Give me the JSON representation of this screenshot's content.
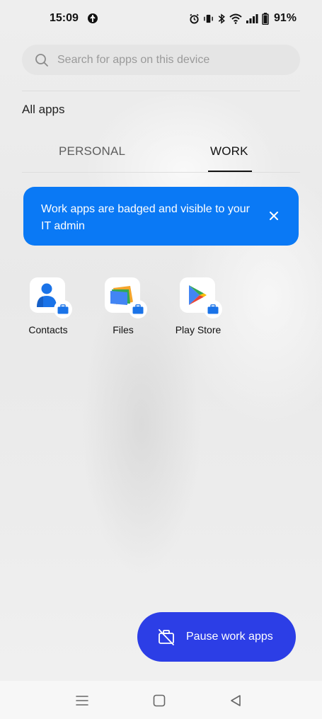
{
  "status_bar": {
    "time": "15:09",
    "battery": "91%",
    "icons": [
      "alarm-icon",
      "vibrate-icon",
      "bluetooth-icon",
      "wifi-icon",
      "signal-icon",
      "battery-icon"
    ]
  },
  "search": {
    "placeholder": "Search for apps on this device"
  },
  "all_apps_label": "All apps",
  "tabs": [
    {
      "label": "PERSONAL",
      "selected": false
    },
    {
      "label": "WORK",
      "selected": true
    }
  ],
  "banner": {
    "text": "Work apps are badged and visible to your IT admin",
    "color": "#0a79f5"
  },
  "apps": [
    {
      "label": "Contacts",
      "icon": "contacts-icon"
    },
    {
      "label": "Files",
      "icon": "files-icon"
    },
    {
      "label": "Play Store",
      "icon": "play-store-icon"
    }
  ],
  "pause_button": {
    "label": "Pause work apps",
    "color": "#2c3ee6"
  },
  "nav_bar": {
    "icons": [
      "menu-icon",
      "home-icon",
      "back-icon"
    ]
  }
}
